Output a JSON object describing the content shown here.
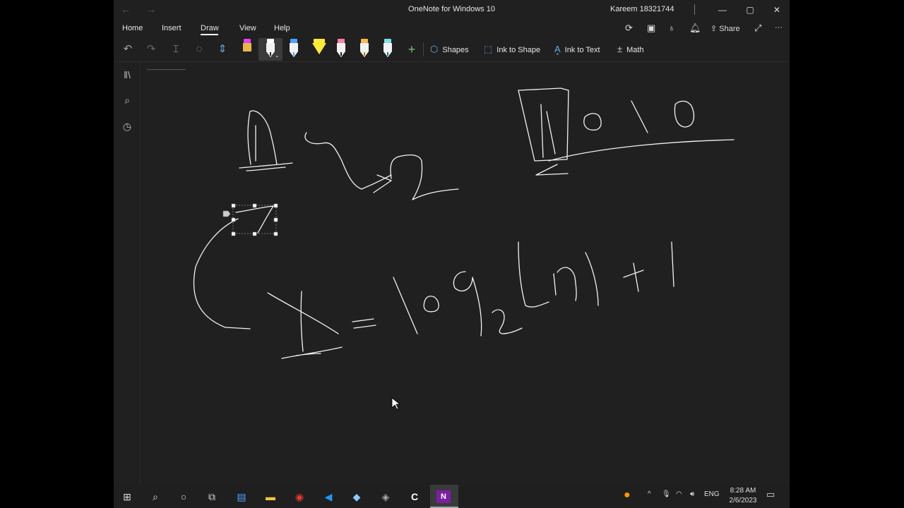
{
  "window": {
    "title": "OneNote for Windows 10",
    "user": "Kareem 18321744",
    "controls": {
      "minimize": "—",
      "maximize": "▢",
      "close": "✕"
    }
  },
  "ribbon": {
    "tabs": [
      "Home",
      "Insert",
      "Draw",
      "View",
      "Help"
    ],
    "active_tab": "Draw",
    "share_label": "Share",
    "more_label": "···"
  },
  "toolbar": {
    "shapes_label": "Shapes",
    "ink_to_shape_label": "Ink to Shape",
    "ink_to_text_label": "Ink to Text",
    "math_label": "Math",
    "pens": [
      {
        "cap": "#e040fb",
        "kind": "pen"
      },
      {
        "cap": "#ffffff",
        "kind": "pen-selected"
      },
      {
        "cap": "#4da3ff",
        "kind": "pen"
      },
      {
        "cap": "#ffeb3b",
        "kind": "highlighter"
      },
      {
        "cap": "#ff80ab",
        "kind": "pen"
      },
      {
        "cap": "#ffb74d",
        "kind": "pen"
      },
      {
        "cap": "#80deea",
        "kind": "pen"
      }
    ]
  },
  "taskbar": {
    "time": "8:28 AM",
    "date": "2/6/2023",
    "language": "ENG"
  },
  "colors": {
    "background": "#202020",
    "ink": "#ffffff",
    "accent": "#6fa8dc"
  }
}
